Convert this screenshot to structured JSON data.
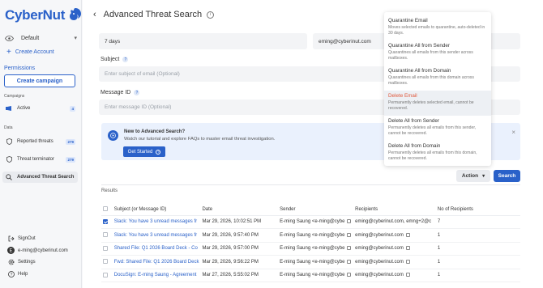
{
  "brand": {
    "name": "CyberNut",
    "color": "#2a61c9"
  },
  "sidebar": {
    "workspace": "Default",
    "create_account": "Create Account",
    "permissions": "Permissions",
    "create_campaign": "Create campaign",
    "campaigns_label": "Campaigns",
    "campaigns": [
      {
        "label": "Active",
        "badge": "4"
      }
    ],
    "data_label": "Data",
    "data_items": [
      {
        "label": "Reported threats",
        "badge": "279"
      },
      {
        "label": "Threat terminator",
        "badge": "279"
      },
      {
        "label": "Advanced Threat Search",
        "badge": ""
      }
    ],
    "footer": [
      {
        "label": "SignOut",
        "icon": "signout-icon"
      },
      {
        "label": "e-ming@cyberinut.com",
        "icon": "user-icon"
      },
      {
        "label": "Settings",
        "icon": "gear-icon"
      },
      {
        "label": "Help",
        "icon": "help-icon"
      }
    ]
  },
  "main": {
    "title": "Advanced Threat Search",
    "date_range": "7 days",
    "email_filter": "eming@cyberinut.com",
    "subject_label": "Subject",
    "subject_placeholder": "Enter subject of email (Optional)",
    "message_id_label": "Message ID",
    "message_id_placeholder": "Enter message ID (Optional)",
    "promo": {
      "title": "New to Advanced Search?",
      "desc": "Watch our tutorial and explore FAQs to master email threat investigation.",
      "button": "Get Started"
    },
    "action_label": "Action",
    "search_label": "Search",
    "results_label": "Results",
    "columns": [
      "Subject (or Message ID)",
      "Date",
      "Sender",
      "Recipients",
      "No of Recipients"
    ],
    "rows": [
      {
        "checked": true,
        "subject": "Slack: You have 3 unread messages fr",
        "date": "Mar 29, 2026, 10:02:51 PM",
        "sender": "E-ming Saung <e-ming@cybe",
        "recipients": "eming@cyberinut.com, emng+2@c",
        "count": "7"
      },
      {
        "checked": false,
        "subject": "Slack: You have 3 unread messages fr",
        "date": "Mar 29, 2026, 9:57:40 PM",
        "sender": "E-ming Saung <e-ming@cybe",
        "recipients": "eming@cyberinut.com",
        "count": "1"
      },
      {
        "checked": false,
        "subject": "Shared File: Q1 2026 Board Deck - Co",
        "date": "Mar 29, 2026, 9:57:00 PM",
        "sender": "E-ming Saung <e-ming@cybe",
        "recipients": "eming@cyberinut.com",
        "count": "1"
      },
      {
        "checked": false,
        "subject": "Fwd: Shared File: Q1 2026 Board Deck",
        "date": "Mar 29, 2026, 9:56:22 PM",
        "sender": "E-ming Saung <e-ming@cybe",
        "recipients": "eming@cyberinut.com",
        "count": "1"
      },
      {
        "checked": false,
        "subject": "DocuSign: E-ming Saung - Agreement",
        "date": "Mar 27, 2026, 5:55:02 PM",
        "sender": "E-ming Saung <e-ming@cybe",
        "recipients": "eming@cyberinut.com",
        "count": "1"
      }
    ]
  },
  "action_menu": [
    {
      "title": "Quarantine Email",
      "desc": "Moves selected emails to quarantine, auto-deleted in 30 days."
    },
    {
      "title": "Quarantine All from Sender",
      "desc": "Quarantines all emails from this sender across mailboxes."
    },
    {
      "title": "Quarantine All from Domain",
      "desc": "Quarantines all emails from this domain across mailboxes."
    },
    {
      "title": "Delete Email",
      "desc": "Permanently deletes selected email, cannot be recovered."
    },
    {
      "title": "Delete All from Sender",
      "desc": "Permanently deletes all emails from this sender, cannot be recovered."
    },
    {
      "title": "Delete All from Domain",
      "desc": "Permanently deletes all emails from this domain, cannot be recovered."
    }
  ]
}
